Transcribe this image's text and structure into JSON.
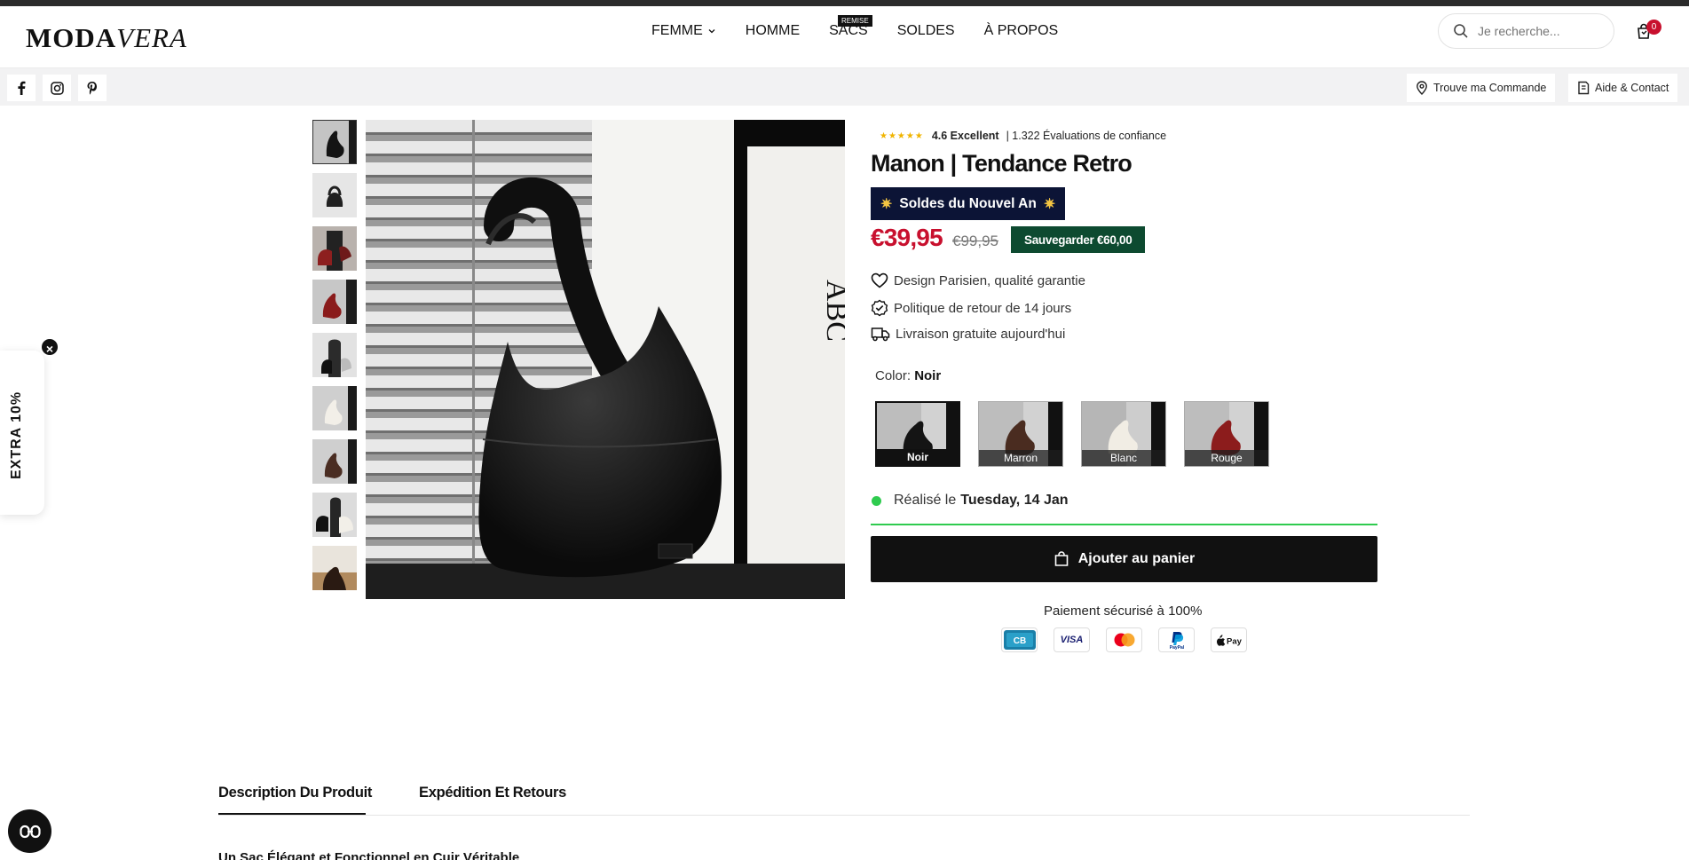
{
  "brand": {
    "logo_bold": "MODA",
    "logo_italic": "VERA"
  },
  "nav": {
    "items": [
      {
        "label": "FEMME"
      },
      {
        "label": "HOMME"
      },
      {
        "label": "SACS"
      },
      {
        "label": "SOLDES"
      },
      {
        "label": "À PROPOS"
      }
    ],
    "sacs_badge": "REMISE"
  },
  "search": {
    "placeholder": "Je recherche..."
  },
  "cart": {
    "count": "0"
  },
  "utility": {
    "track_order": "Trouve ma Commande",
    "help_contact": "Aide & Contact"
  },
  "social": [
    "facebook-icon",
    "instagram-icon",
    "pinterest-icon"
  ],
  "product": {
    "rating_score": "4.6 Excellent",
    "rating_count": "| 1.322 Évaluations de confiance",
    "rating_stars": 5,
    "title": "Manon | Tendance Retro",
    "promo": "Soldes du Nouvel An",
    "price": "€39,95",
    "old_price": "€99,95",
    "save": "Sauvegarder €60,00",
    "features": [
      "Design Parisien, qualité garantie",
      "Politique de retour de 14 jours",
      "Livraison gratuite aujourd'hui"
    ],
    "color_label": "Color:",
    "color_selected": "Noir",
    "colors": [
      "Noir",
      "Marron",
      "Blanc",
      "Rouge"
    ],
    "delivery_prefix": "Réalisé le",
    "delivery_date": "Tuesday, 14 Jan",
    "add_to_cart": "Ajouter au panier",
    "secure_payment": "Paiement sécurisé à 100%",
    "payment_methods": [
      "CB",
      "VISA",
      "Mastercard",
      "PayPal",
      "Apple Pay"
    ]
  },
  "tabs": [
    "Description Du Produit",
    "Expédition Et Retours"
  ],
  "description_peek": "Un Sac Élégant et Fonctionnel en Cuir Véritable",
  "popup": {
    "extra": "EXTRA 10%"
  },
  "colors": {
    "accent_red": "#c8102e",
    "promo_navy": "#0c1436",
    "save_green": "#0d4a30",
    "status_green": "#2fcb4f"
  }
}
